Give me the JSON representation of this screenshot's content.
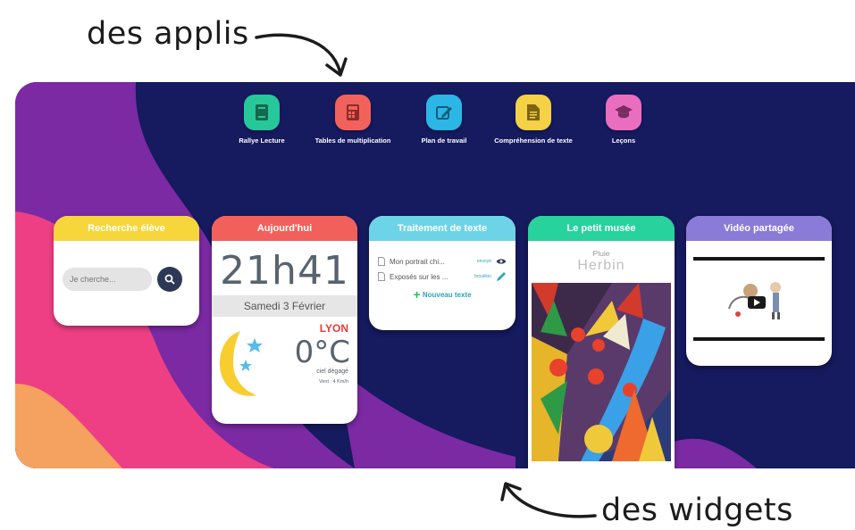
{
  "annotations": {
    "top": "des applis",
    "bottom": "des widgets"
  },
  "apps": [
    {
      "label": "Rallye Lecture",
      "icon": "book-icon",
      "color": "#26c89a"
    },
    {
      "label": "Tables de multiplication",
      "icon": "calculator-icon",
      "color": "#f2625d"
    },
    {
      "label": "Plan de travail",
      "icon": "edit-icon",
      "color": "#2bb6e6"
    },
    {
      "label": "Compréhension de texte",
      "icon": "document-icon",
      "color": "#f5d145"
    },
    {
      "label": "Leçons",
      "icon": "graduation-cap-icon",
      "color": "#ea6ec0"
    }
  ],
  "widgets": {
    "search": {
      "title": "Recherche élève",
      "placeholder": "Je cherche...",
      "color": "#f6d63a"
    },
    "today": {
      "title": "Aujourd'hui",
      "time": "21h41",
      "date": "Samedi 3 Février",
      "city": "LYON",
      "temperature": "0°C",
      "sky": "ciel dégagé",
      "wind": "Vent : 4 Km/h",
      "color": "#f2605c"
    },
    "text": {
      "title": "Traitement de texte",
      "docs": [
        {
          "name": "Mon portrait chi...",
          "tag": "envoyé"
        },
        {
          "name": "Exposés sur les ...",
          "tag": "brouillon"
        }
      ],
      "new_label": "Nouveau texte",
      "color": "#6dd4e8"
    },
    "museum": {
      "title": "Le petit musée",
      "artwork": "Pluie",
      "artist": "Herbin",
      "color": "#27d29c"
    },
    "video": {
      "title": "Vidéo partagée",
      "color": "#8b7bd8"
    }
  },
  "colors": {
    "board": "#161a5e",
    "purple": "#7b2aa3",
    "pink": "#ef3f84",
    "orange": "#f5a15f"
  }
}
